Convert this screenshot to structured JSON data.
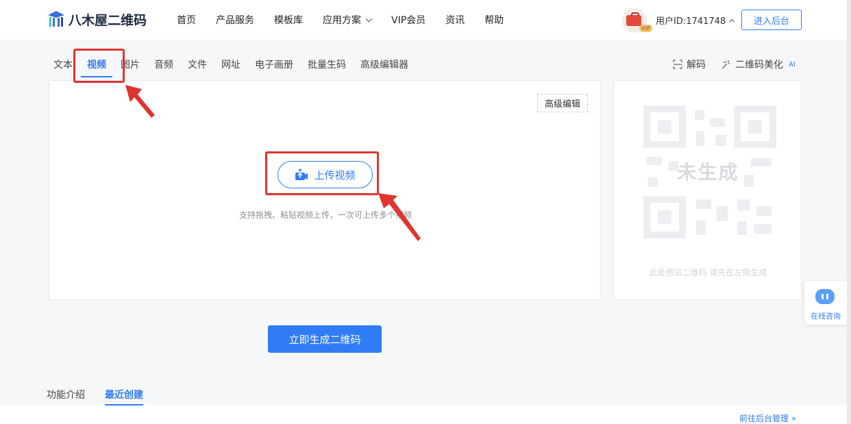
{
  "header": {
    "logo_text": "八木屋二维码",
    "nav": [
      "首页",
      "产品服务",
      "模板库",
      "应用方案",
      "VIP会员",
      "资讯",
      "帮助"
    ],
    "vip_badge": "VIP",
    "user_id": "用户ID:1741748",
    "enter_button": "进入后台"
  },
  "tabs": [
    "文本",
    "视频",
    "图片",
    "音频",
    "文件",
    "网址",
    "电子画册",
    "批量生码",
    "高级编辑器"
  ],
  "active_tab": "视频",
  "tools": {
    "decode": "解码",
    "beautify": "二维码美化",
    "ai": "AI"
  },
  "editor": {
    "advanced_button": "高级编辑",
    "upload_button": "上传视频",
    "upload_hint": "支持拖拽、粘贴视频上传，一次可上传多个视频"
  },
  "preview": {
    "not_generated": "未生成",
    "hint": "此处预览二维码 请先在左侧生成"
  },
  "generate_button": "立即生成二维码",
  "bottom_tabs": [
    "功能介绍",
    "最近创建"
  ],
  "manage_link": "前往后台管理 »",
  "consult": {
    "label": "在线咨询"
  },
  "colors": {
    "accent": "#2f7cf6",
    "annotation": "#e0342f"
  }
}
